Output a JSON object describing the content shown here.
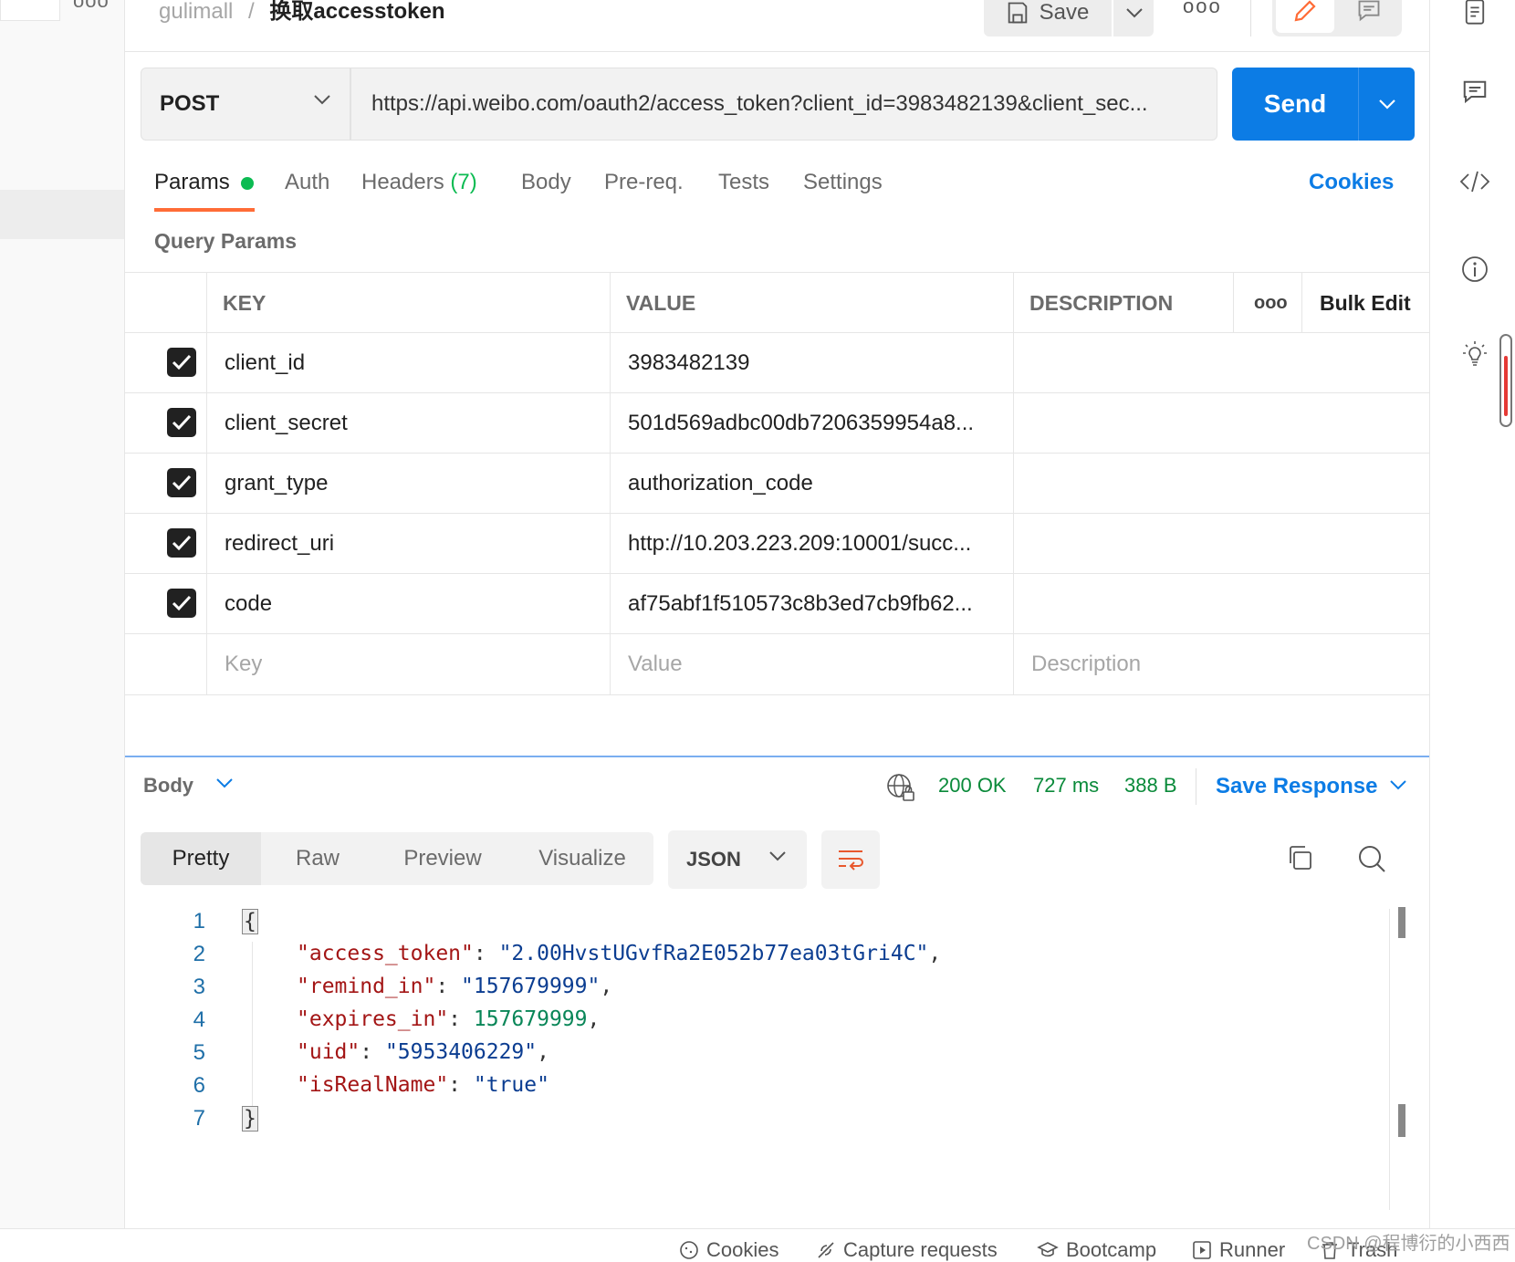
{
  "header": {
    "collection": "gulimall",
    "separator": "/",
    "request_name": "换取accesstoken",
    "save_label": "Save",
    "more_label": "ooo"
  },
  "request": {
    "method": "POST",
    "url": "https://api.weibo.com/oauth2/access_token?client_id=3983482139&client_sec...",
    "send_label": "Send"
  },
  "tabs": [
    {
      "label": "Params"
    },
    {
      "label": "Auth"
    },
    {
      "label": "Headers",
      "count": "(7)"
    },
    {
      "label": "Body"
    },
    {
      "label": "Pre-req."
    },
    {
      "label": "Tests"
    },
    {
      "label": "Settings"
    }
  ],
  "cookies_label": "Cookies",
  "query_params": {
    "title": "Query Params",
    "columns": {
      "key": "KEY",
      "value": "VALUE",
      "description": "DESCRIPTION",
      "more": "ooo",
      "bulk_edit": "Bulk Edit"
    },
    "rows": [
      {
        "key": "client_id",
        "value": "3983482139"
      },
      {
        "key": "client_secret",
        "value": "501d569adbc00db7206359954a8..."
      },
      {
        "key": "grant_type",
        "value": "authorization_code"
      },
      {
        "key": "redirect_uri",
        "value": "http://10.203.223.209:10001/succ..."
      },
      {
        "key": "code",
        "value": "af75abf1f510573c8b3ed7cb9fb62..."
      }
    ],
    "placeholders": {
      "key": "Key",
      "value": "Value",
      "description": "Description"
    }
  },
  "response": {
    "body_label": "Body",
    "status": "200 OK",
    "time": "727 ms",
    "size": "388 B",
    "save_response_label": "Save Response",
    "views": [
      "Pretty",
      "Raw",
      "Preview",
      "Visualize"
    ],
    "format": "JSON",
    "line_numbers": [
      "1",
      "2",
      "3",
      "4",
      "5",
      "6",
      "7"
    ],
    "json": {
      "open": "{",
      "close": "}",
      "access_token_key": "\"access_token\"",
      "access_token_val": "\"2.00HvstUGvfRa2E052b77ea03tGri4C\"",
      "remind_in_key": "\"remind_in\"",
      "remind_in_val": "\"157679999\"",
      "expires_in_key": "\"expires_in\"",
      "expires_in_val": "157679999",
      "uid_key": "\"uid\"",
      "uid_val": "\"5953406229\"",
      "is_real_name_key": "\"isRealName\"",
      "is_real_name_val": "\"true\""
    }
  },
  "footer": {
    "items": [
      "Cookies",
      "Capture requests",
      "Bootcamp",
      "Runner",
      "Trash"
    ],
    "watermark": "CSDN @程博衍的小西西"
  },
  "colors": {
    "accent_blue": "#0c7ce5",
    "tab_underline": "#ff6c37",
    "status_green": "#0a8a3a",
    "params_dot": "#0cbb52"
  }
}
